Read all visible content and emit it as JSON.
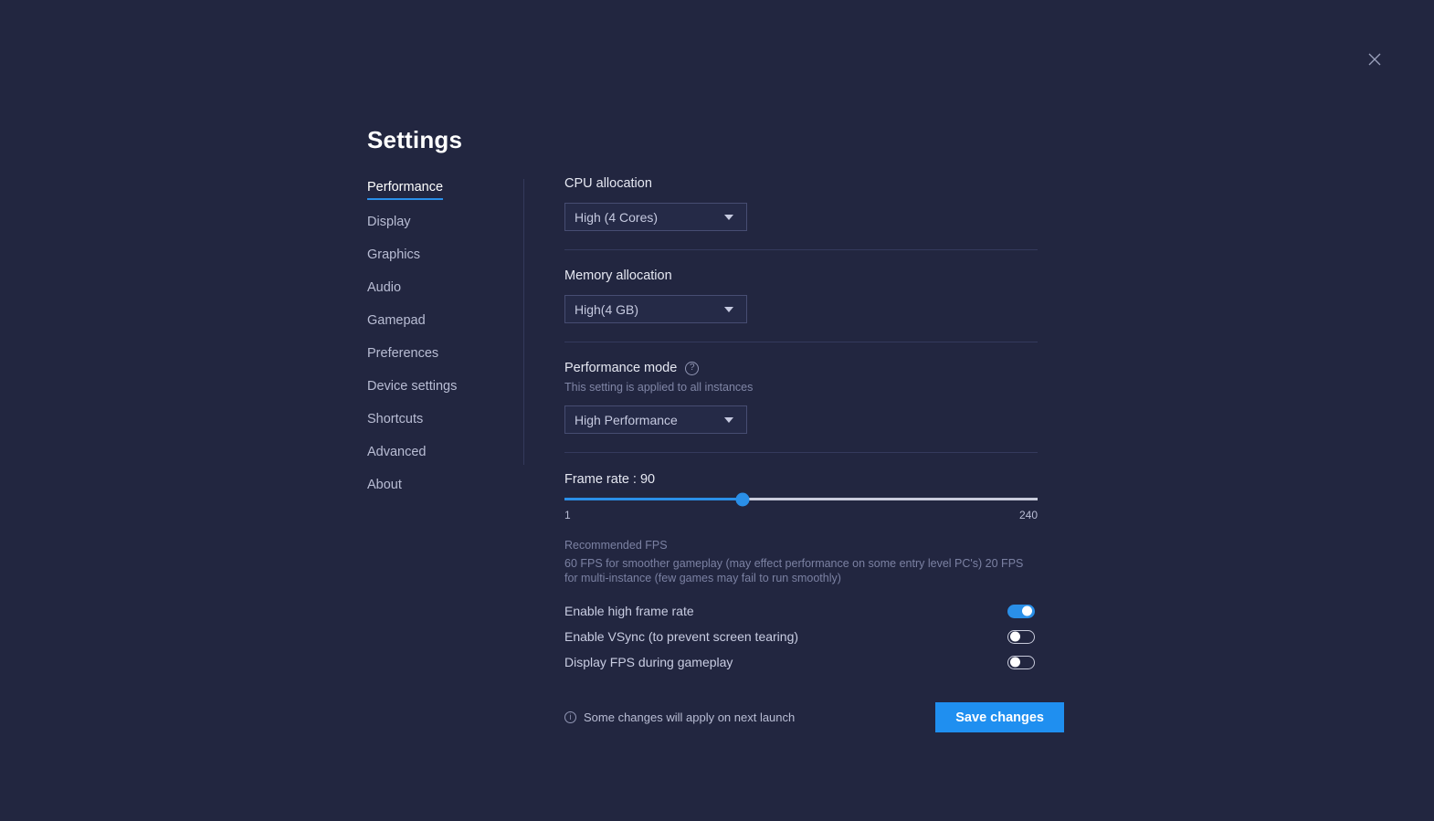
{
  "window": {
    "close_icon": "close-icon"
  },
  "title": "Settings",
  "sidebar": {
    "items": [
      {
        "label": "Performance",
        "active": true
      },
      {
        "label": "Display",
        "active": false
      },
      {
        "label": "Graphics",
        "active": false
      },
      {
        "label": "Audio",
        "active": false
      },
      {
        "label": "Gamepad",
        "active": false
      },
      {
        "label": "Preferences",
        "active": false
      },
      {
        "label": "Device settings",
        "active": false
      },
      {
        "label": "Shortcuts",
        "active": false
      },
      {
        "label": "Advanced",
        "active": false
      },
      {
        "label": "About",
        "active": false
      }
    ]
  },
  "main": {
    "cpu": {
      "label": "CPU allocation",
      "value": "High (4 Cores)"
    },
    "memory": {
      "label": "Memory allocation",
      "value": "High(4 GB)"
    },
    "performance_mode": {
      "label": "Performance mode",
      "help_icon": "help-circle-icon",
      "note": "This setting is applied to all instances",
      "value": "High Performance"
    },
    "frame_rate": {
      "label": "Frame rate : 90",
      "value": 90,
      "min_label": "1",
      "max_label": "240",
      "min": 1,
      "max": 240,
      "fill_percent": 37.6
    },
    "recommended": {
      "heading": "Recommended FPS",
      "body": "60 FPS for smoother gameplay (may effect performance on some entry level PC's) 20 FPS for multi-instance (few games may fail to run smoothly)"
    },
    "toggles": [
      {
        "label": "Enable high frame rate",
        "on": true
      },
      {
        "label": "Enable VSync (to prevent screen tearing)",
        "on": false
      },
      {
        "label": "Display FPS during gameplay",
        "on": false
      }
    ]
  },
  "footer": {
    "info_icon": "info-circle-icon",
    "note": "Some changes will apply on next launch",
    "save_label": "Save changes"
  },
  "colors": {
    "background": "#222640",
    "accent": "#2a8fe8",
    "save_button": "#1f8ff0",
    "text_primary": "#e6e8f2",
    "text_muted": "#7b81a2"
  }
}
